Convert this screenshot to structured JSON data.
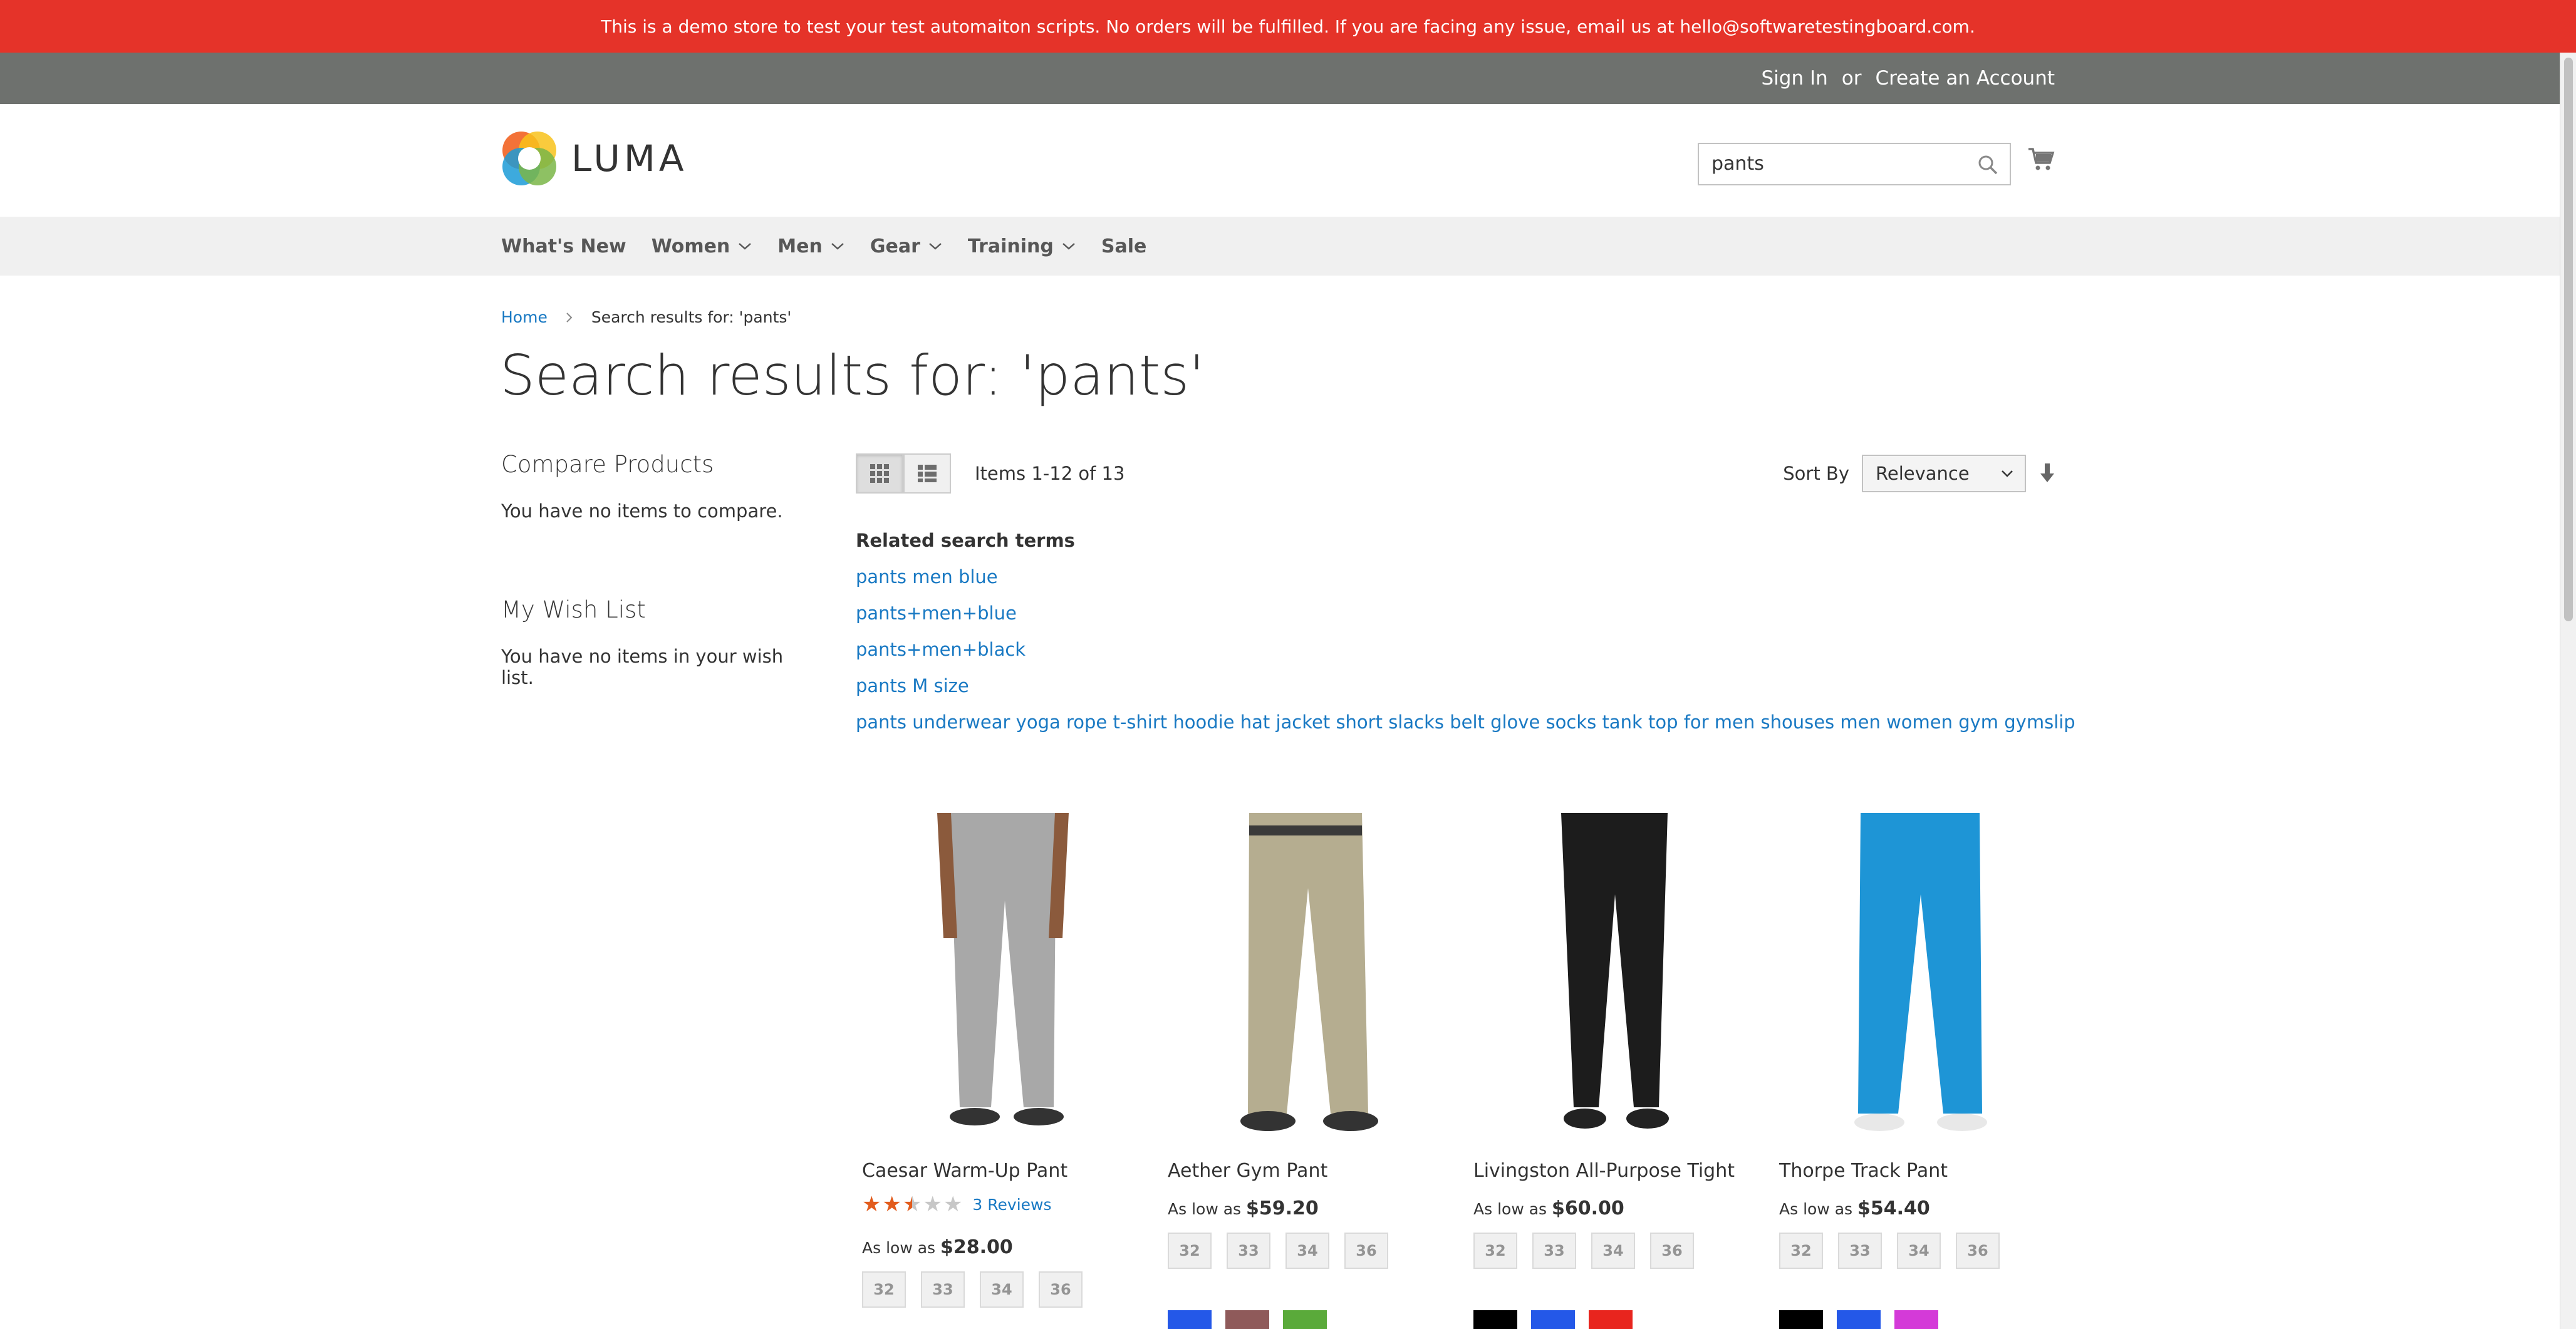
{
  "promo": {
    "text": "This is a demo store to test your test automaiton scripts. No orders will be fulfilled. If you are facing any issue, email us at hello@softwaretestingboard.com."
  },
  "header_links": {
    "sign_in": "Sign In",
    "or": "or",
    "create_account": "Create an Account"
  },
  "logo": {
    "text": "LUMA"
  },
  "search": {
    "value": "pants"
  },
  "nav": {
    "items": [
      {
        "label": "What's New",
        "has_submenu": false
      },
      {
        "label": "Women",
        "has_submenu": true
      },
      {
        "label": "Men",
        "has_submenu": true
      },
      {
        "label": "Gear",
        "has_submenu": true
      },
      {
        "label": "Training",
        "has_submenu": true
      },
      {
        "label": "Sale",
        "has_submenu": false
      }
    ]
  },
  "breadcrumb": {
    "home": "Home",
    "current": "Search results for: 'pants'"
  },
  "page_title": "Search results for: 'pants'",
  "sidebar": {
    "compare_title": "Compare Products",
    "compare_text": "You have no items to compare.",
    "wishlist_title": "My Wish List",
    "wishlist_text": "You have no items in your wish list."
  },
  "toolbar": {
    "amount": "Items 1-12 of 13",
    "sort_label": "Sort By",
    "sort_value": "Relevance",
    "active_mode": "grid"
  },
  "related": {
    "title": "Related search terms",
    "terms": [
      "pants men blue",
      "pants+men+blue",
      "pants+men+black",
      "pants M size",
      "pants underwear yoga rope t-shirt hoodie hat jacket short slacks belt glove socks tank top for men shouses men women gym gymslip"
    ]
  },
  "products": [
    {
      "name": "Caesar Warm-Up Pant",
      "rating_stars": 2.5,
      "reviews": "3 Reviews",
      "price_prefix": "As low as",
      "price": "$28.00",
      "sizes": [
        "32",
        "33",
        "34",
        "36"
      ],
      "swatches": [],
      "pant_color": "#a8a8a8"
    },
    {
      "name": "Aether Gym Pant",
      "price_prefix": "As low as",
      "price": "$59.20",
      "sizes": [
        "32",
        "33",
        "34",
        "36"
      ],
      "swatches": [
        "#2458e8",
        "#8f5a5a",
        "#5aaa3a"
      ],
      "pant_color": "#b5ad90"
    },
    {
      "name": "Livingston All-Purpose Tight",
      "price_prefix": "As low as",
      "price": "$60.00",
      "sizes": [
        "32",
        "33",
        "34",
        "36"
      ],
      "swatches": [
        "#000000",
        "#2458e8",
        "#e8251e"
      ],
      "pant_color": "#1c1c1c"
    },
    {
      "name": "Thorpe Track Pant",
      "price_prefix": "As low as",
      "price": "$54.40",
      "sizes": [
        "32",
        "33",
        "34",
        "36"
      ],
      "swatches": [
        "#000000",
        "#2458e8",
        "#d43ad8"
      ],
      "pant_color": "#1e95d6"
    }
  ],
  "colors": {
    "promo_bg": "#e53329",
    "topbar_bg": "#6e716e",
    "nav_bg": "#f0f0f0",
    "link": "#1979c3",
    "star": "#e25c1d"
  }
}
